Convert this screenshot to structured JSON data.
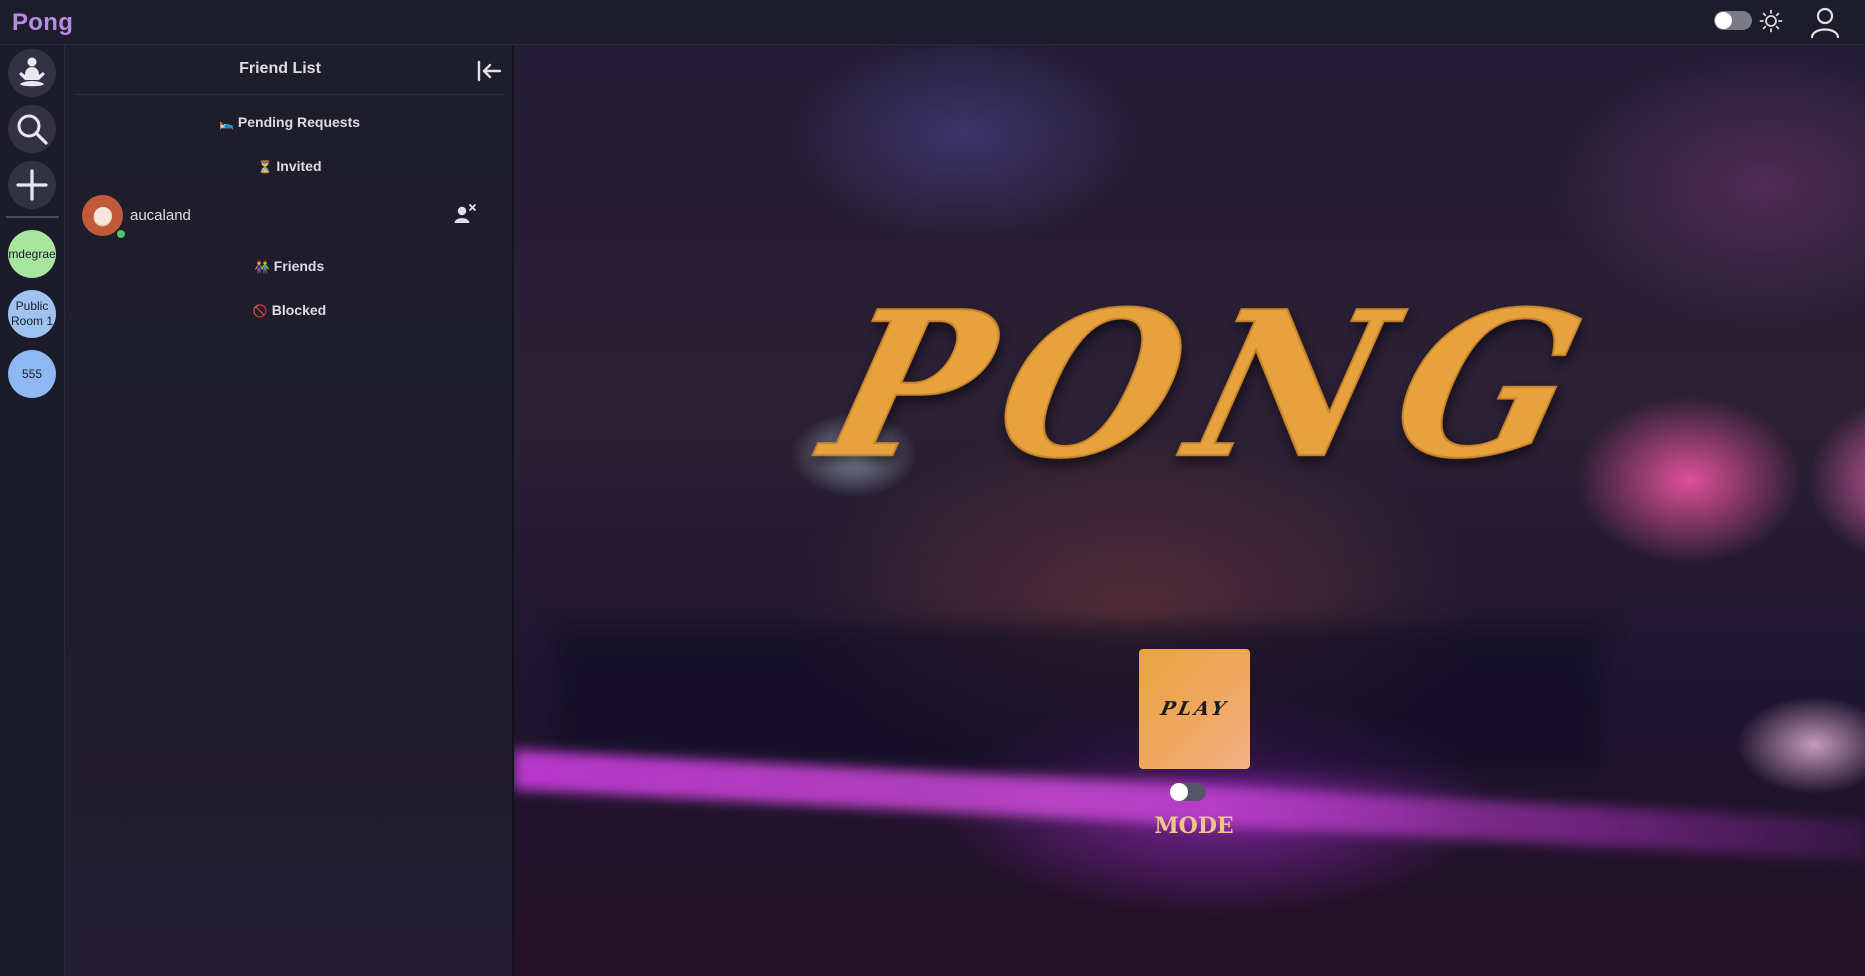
{
  "app": {
    "title": "Pong"
  },
  "topbar": {
    "theme_toggle_state": "off",
    "theme_icon": "sun-icon",
    "profile_icon": "user-icon"
  },
  "rail": {
    "buttons": [
      {
        "icon": "meditation-icon"
      },
      {
        "icon": "search-icon"
      },
      {
        "icon": "plus-icon"
      }
    ],
    "rooms": [
      {
        "label": "mdegrae",
        "color": "#a8e6a0"
      },
      {
        "label": "Public Room 1",
        "color": "#9ec3f0"
      },
      {
        "label": "555",
        "color": "#8fb8f2"
      }
    ]
  },
  "friend_panel": {
    "title": "Friend List",
    "sections": {
      "pending": {
        "emoji": "🛌",
        "label": "Pending Requests"
      },
      "invited": {
        "emoji": "⏳",
        "label": "Invited"
      },
      "friends": {
        "emoji": "👫",
        "label": "Friends"
      },
      "blocked": {
        "emoji": "🚫",
        "label": "Blocked"
      }
    },
    "invited_users": [
      {
        "name": "aucaland",
        "status": "online"
      }
    ]
  },
  "main": {
    "logo_text": "PONG",
    "play_label": "PLAY",
    "mode_toggle_state": "off",
    "mode_label": "MODE"
  },
  "colors": {
    "brand": "#b88ae6",
    "logo": "#e8a23e",
    "mode_label": "#f0c58a",
    "online": "#56c26a"
  }
}
